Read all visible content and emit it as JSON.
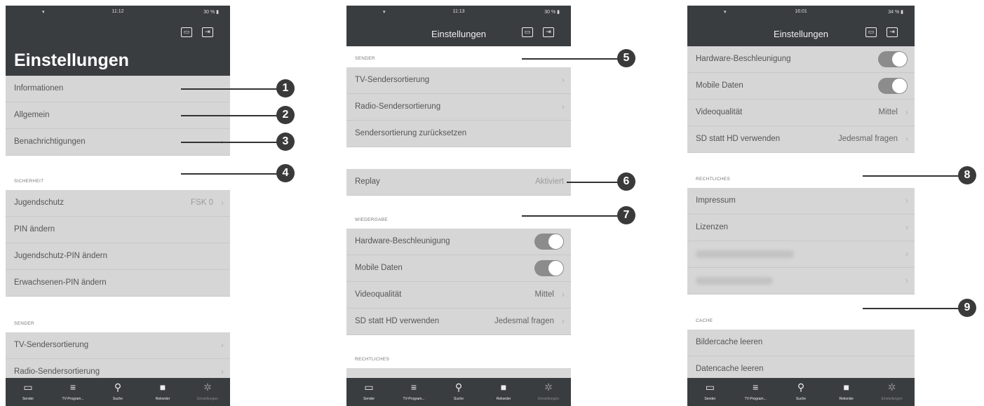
{
  "phone1": {
    "status": {
      "wifi": "▾",
      "time": "11:12",
      "battery": "30 % ▮"
    },
    "title": "Einstellungen",
    "rows_a": [
      {
        "label": "Informationen",
        "value": "",
        "chevron": ""
      },
      {
        "label": "Allgemein",
        "value": "",
        "chevron": ""
      },
      {
        "label": "Benachrichtigungen",
        "value": "",
        "chevron": "›"
      }
    ],
    "section_sicherheit": "SICHERHEIT",
    "rows_b": [
      {
        "label": "Jugendschutz",
        "value": "FSK 0",
        "chevron": "›"
      },
      {
        "label": "PIN ändern",
        "value": "",
        "chevron": ""
      },
      {
        "label": "Jugendschutz-PIN ändern",
        "value": "",
        "chevron": ""
      },
      {
        "label": "Erwachsenen-PIN ändern",
        "value": "",
        "chevron": ""
      }
    ],
    "section_sender": "SENDER",
    "rows_c": [
      {
        "label": "TV-Sendersortierung",
        "value": "",
        "chevron": "›"
      },
      {
        "label": "Radio-Sendersortierung",
        "value": "",
        "chevron": "›"
      }
    ]
  },
  "phone2": {
    "status": {
      "wifi": "▾",
      "time": "11:13",
      "battery": "30 % ▮"
    },
    "title": "Einstellungen",
    "section_sender": "SENDER",
    "rows_a": [
      {
        "label": "TV-Sendersortierung",
        "value": "",
        "chevron": "›"
      },
      {
        "label": "Radio-Sendersortierung",
        "value": "",
        "chevron": "›"
      },
      {
        "label": "Sendersortierung zurücksetzen",
        "value": "",
        "chevron": ""
      }
    ],
    "replay": {
      "label": "Replay",
      "value": "Aktiviert"
    },
    "section_wiedergabe": "WIEDERGABE",
    "toggles": [
      {
        "label": "Hardware-Beschleunigung",
        "on": true
      },
      {
        "label": "Mobile Daten",
        "on": true
      }
    ],
    "rows_b": [
      {
        "label": "Videoqualität",
        "value": "Mittel",
        "chevron": "›"
      },
      {
        "label": "SD statt HD verwenden",
        "value": "Jedesmal fragen",
        "chevron": "›"
      }
    ],
    "section_rechtliches": "RECHTLICHES"
  },
  "phone3": {
    "status": {
      "wifi": "▾",
      "time": "16:01",
      "battery": "34 % ▮"
    },
    "title": "Einstellungen",
    "toggles": [
      {
        "label": "Hardware-Beschleunigung",
        "on": true
      },
      {
        "label": "Mobile Daten",
        "on": true
      }
    ],
    "rows_a": [
      {
        "label": "Videoqualität",
        "value": "Mittel",
        "chevron": "›"
      },
      {
        "label": "SD statt HD verwenden",
        "value": "Jedesmal fragen",
        "chevron": "›"
      }
    ],
    "section_rechtliches": "RECHTLICHES",
    "rows_b": [
      {
        "label": "Impressum",
        "value": "",
        "chevron": "›"
      },
      {
        "label": "Lizenzen",
        "value": "",
        "chevron": "›"
      }
    ],
    "blurred_chevrons": [
      "›",
      "›"
    ],
    "section_cache": "CACHE",
    "rows_c": [
      {
        "label": "Bildercache leeren",
        "value": "",
        "chevron": ""
      },
      {
        "label": "Datencache leeren",
        "value": "",
        "chevron": ""
      }
    ]
  },
  "tabs": [
    {
      "icon": "▭",
      "label": "Sender",
      "dim": false
    },
    {
      "icon": "≡",
      "label": "TV-Program...",
      "dim": false
    },
    {
      "icon": "⚲",
      "label": "Suche",
      "dim": false
    },
    {
      "icon": "■",
      "label": "Rekorder",
      "dim": false
    },
    {
      "icon": "✲",
      "label": "Einstellungen",
      "dim": true
    }
  ],
  "header_icons": {
    "cast": "▭",
    "exit": "⇥"
  },
  "callouts": [
    "1",
    "2",
    "3",
    "4",
    "5",
    "6",
    "7",
    "8",
    "9"
  ]
}
